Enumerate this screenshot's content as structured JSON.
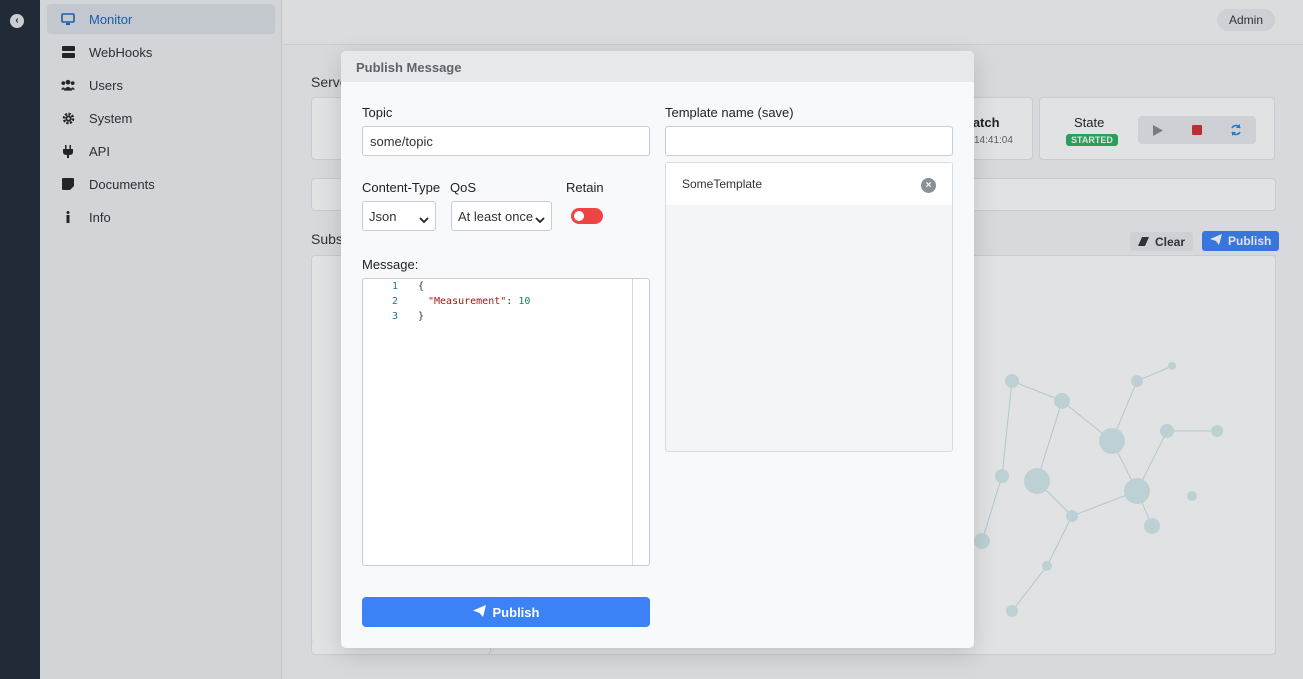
{
  "sidebar": {
    "items": [
      {
        "label": "Monitor",
        "icon": "monitor-icon",
        "active": true
      },
      {
        "label": "WebHooks",
        "icon": "server-icon"
      },
      {
        "label": "Users",
        "icon": "users-icon"
      },
      {
        "label": "System",
        "icon": "gear-icon"
      },
      {
        "label": "API",
        "icon": "plug-icon"
      },
      {
        "label": "Documents",
        "icon": "note-icon"
      },
      {
        "label": "Info",
        "icon": "info-icon"
      }
    ]
  },
  "header": {
    "user": "Admin"
  },
  "background": {
    "server_section": "Serve",
    "match_label": "Match",
    "match_time": "14:41:04",
    "state_label": "State",
    "state_value": "STARTED",
    "subs_section": "Subs",
    "clear_label": "Clear",
    "publish_label": "Publish"
  },
  "modal": {
    "title": "Publish Message",
    "topic_label": "Topic",
    "topic_value": "some/topic",
    "content_type_label": "Content-Type",
    "content_type_value": "Json",
    "qos_label": "QoS",
    "qos_value": "At least once",
    "retain_label": "Retain",
    "retain_on": false,
    "message_label": "Message:",
    "editor_lines": [
      {
        "n": "1",
        "text": "{"
      },
      {
        "n": "2",
        "key": "\"Measurement\"",
        "sep": ": ",
        "value": "10"
      },
      {
        "n": "3",
        "text": "}"
      }
    ],
    "publish_label": "Publish",
    "template_label": "Template name (save)",
    "template_value": "",
    "templates": [
      "SomeTemplate"
    ]
  },
  "colors": {
    "accent": "#3b82f6",
    "sidebar_dark": "#1f2a37",
    "retain_toggle": "#ef4444",
    "state_started": "#2ab060"
  }
}
